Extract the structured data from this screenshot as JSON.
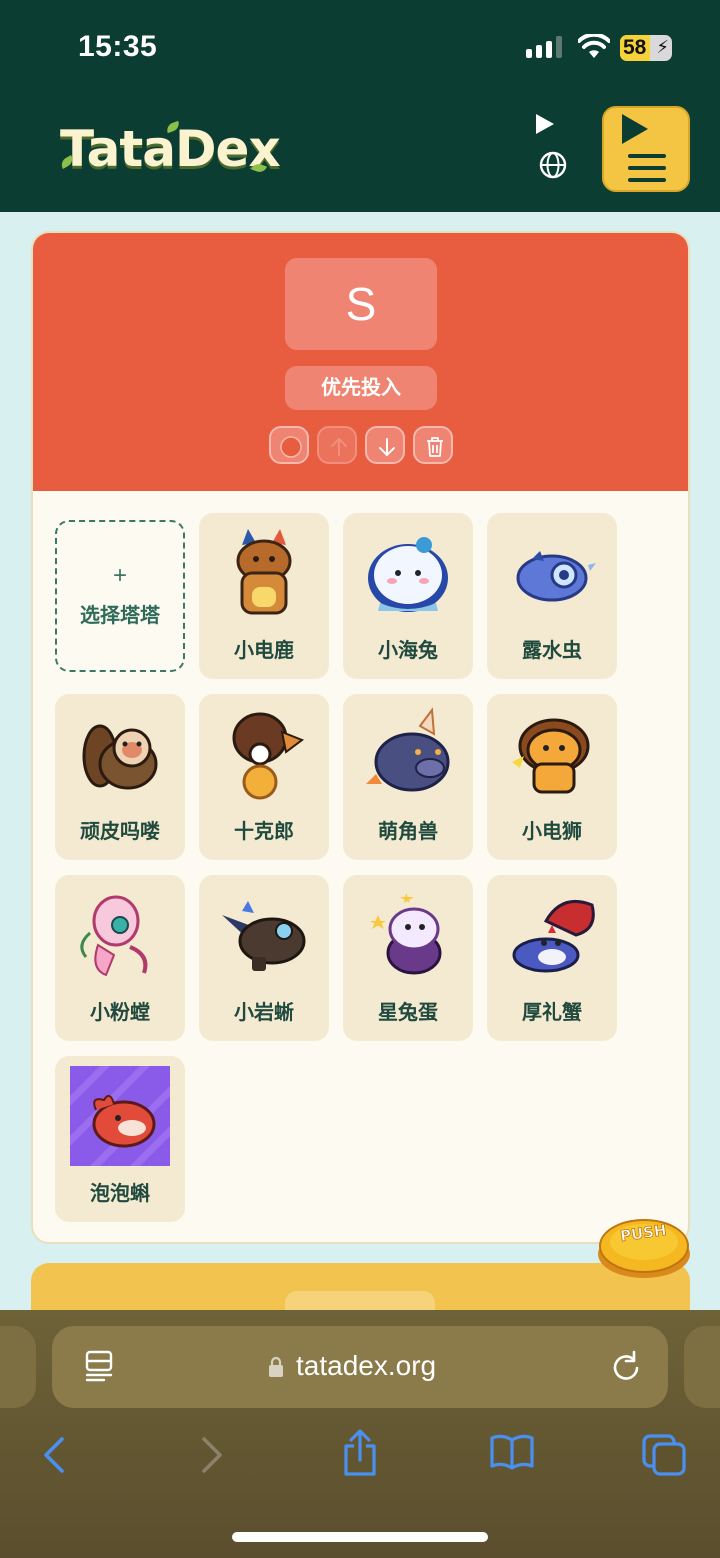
{
  "status": {
    "time": "15:35",
    "battery": "58"
  },
  "header": {
    "logo": "TataDex"
  },
  "tier": {
    "letter": "S",
    "label": "优先投入"
  },
  "add_tile": {
    "plus": "+",
    "label": "选择塔塔"
  },
  "creatures": [
    {
      "name": "小电鹿",
      "icon": "deer-creature"
    },
    {
      "name": "小海兔",
      "icon": "sea-bunny-creature"
    },
    {
      "name": "露水虫",
      "icon": "dew-bug-creature"
    },
    {
      "name": "顽皮吗喽",
      "icon": "monkey-creature"
    },
    {
      "name": "十克郎",
      "icon": "shell-creature"
    },
    {
      "name": "萌角兽",
      "icon": "horned-beast-creature"
    },
    {
      "name": "小电狮",
      "icon": "lion-creature"
    },
    {
      "name": "小粉螳",
      "icon": "pink-mantis-creature"
    },
    {
      "name": "小岩蜥",
      "icon": "rock-lizard-creature"
    },
    {
      "name": "星兔蛋",
      "icon": "star-egg-creature"
    },
    {
      "name": "厚礼蟹",
      "icon": "crab-creature"
    },
    {
      "name": "泡泡蝌",
      "icon": "bubble-tadpole-creature"
    }
  ],
  "push_button": {
    "label": "PUSH"
  },
  "browser": {
    "url": "tatadex.org"
  },
  "colors": {
    "header": "#0c3d33",
    "tier_s": "#e85d40",
    "tile": "#f4ead2",
    "accent": "#f4c542"
  }
}
